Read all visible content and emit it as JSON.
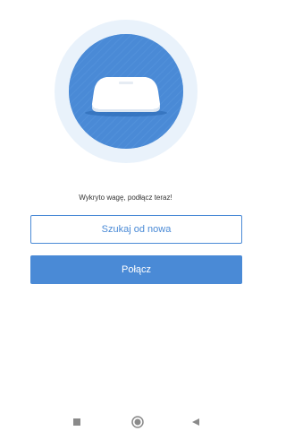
{
  "scale_prompt": {
    "status_text": "Wykryto wagę, podłącz teraz!"
  },
  "buttons": {
    "rescan_label": "Szukaj od nowa",
    "connect_label": "Połącz"
  },
  "icons": {
    "hero": "bathroom-scale-icon",
    "nav_recent": "square-icon",
    "nav_home": "circle-icon",
    "nav_back": "triangle-left-icon"
  },
  "colors": {
    "accent": "#4a8ad6",
    "halo": "#e9f2fb",
    "text": "#333333",
    "nav_icon": "#8a8a8a"
  }
}
